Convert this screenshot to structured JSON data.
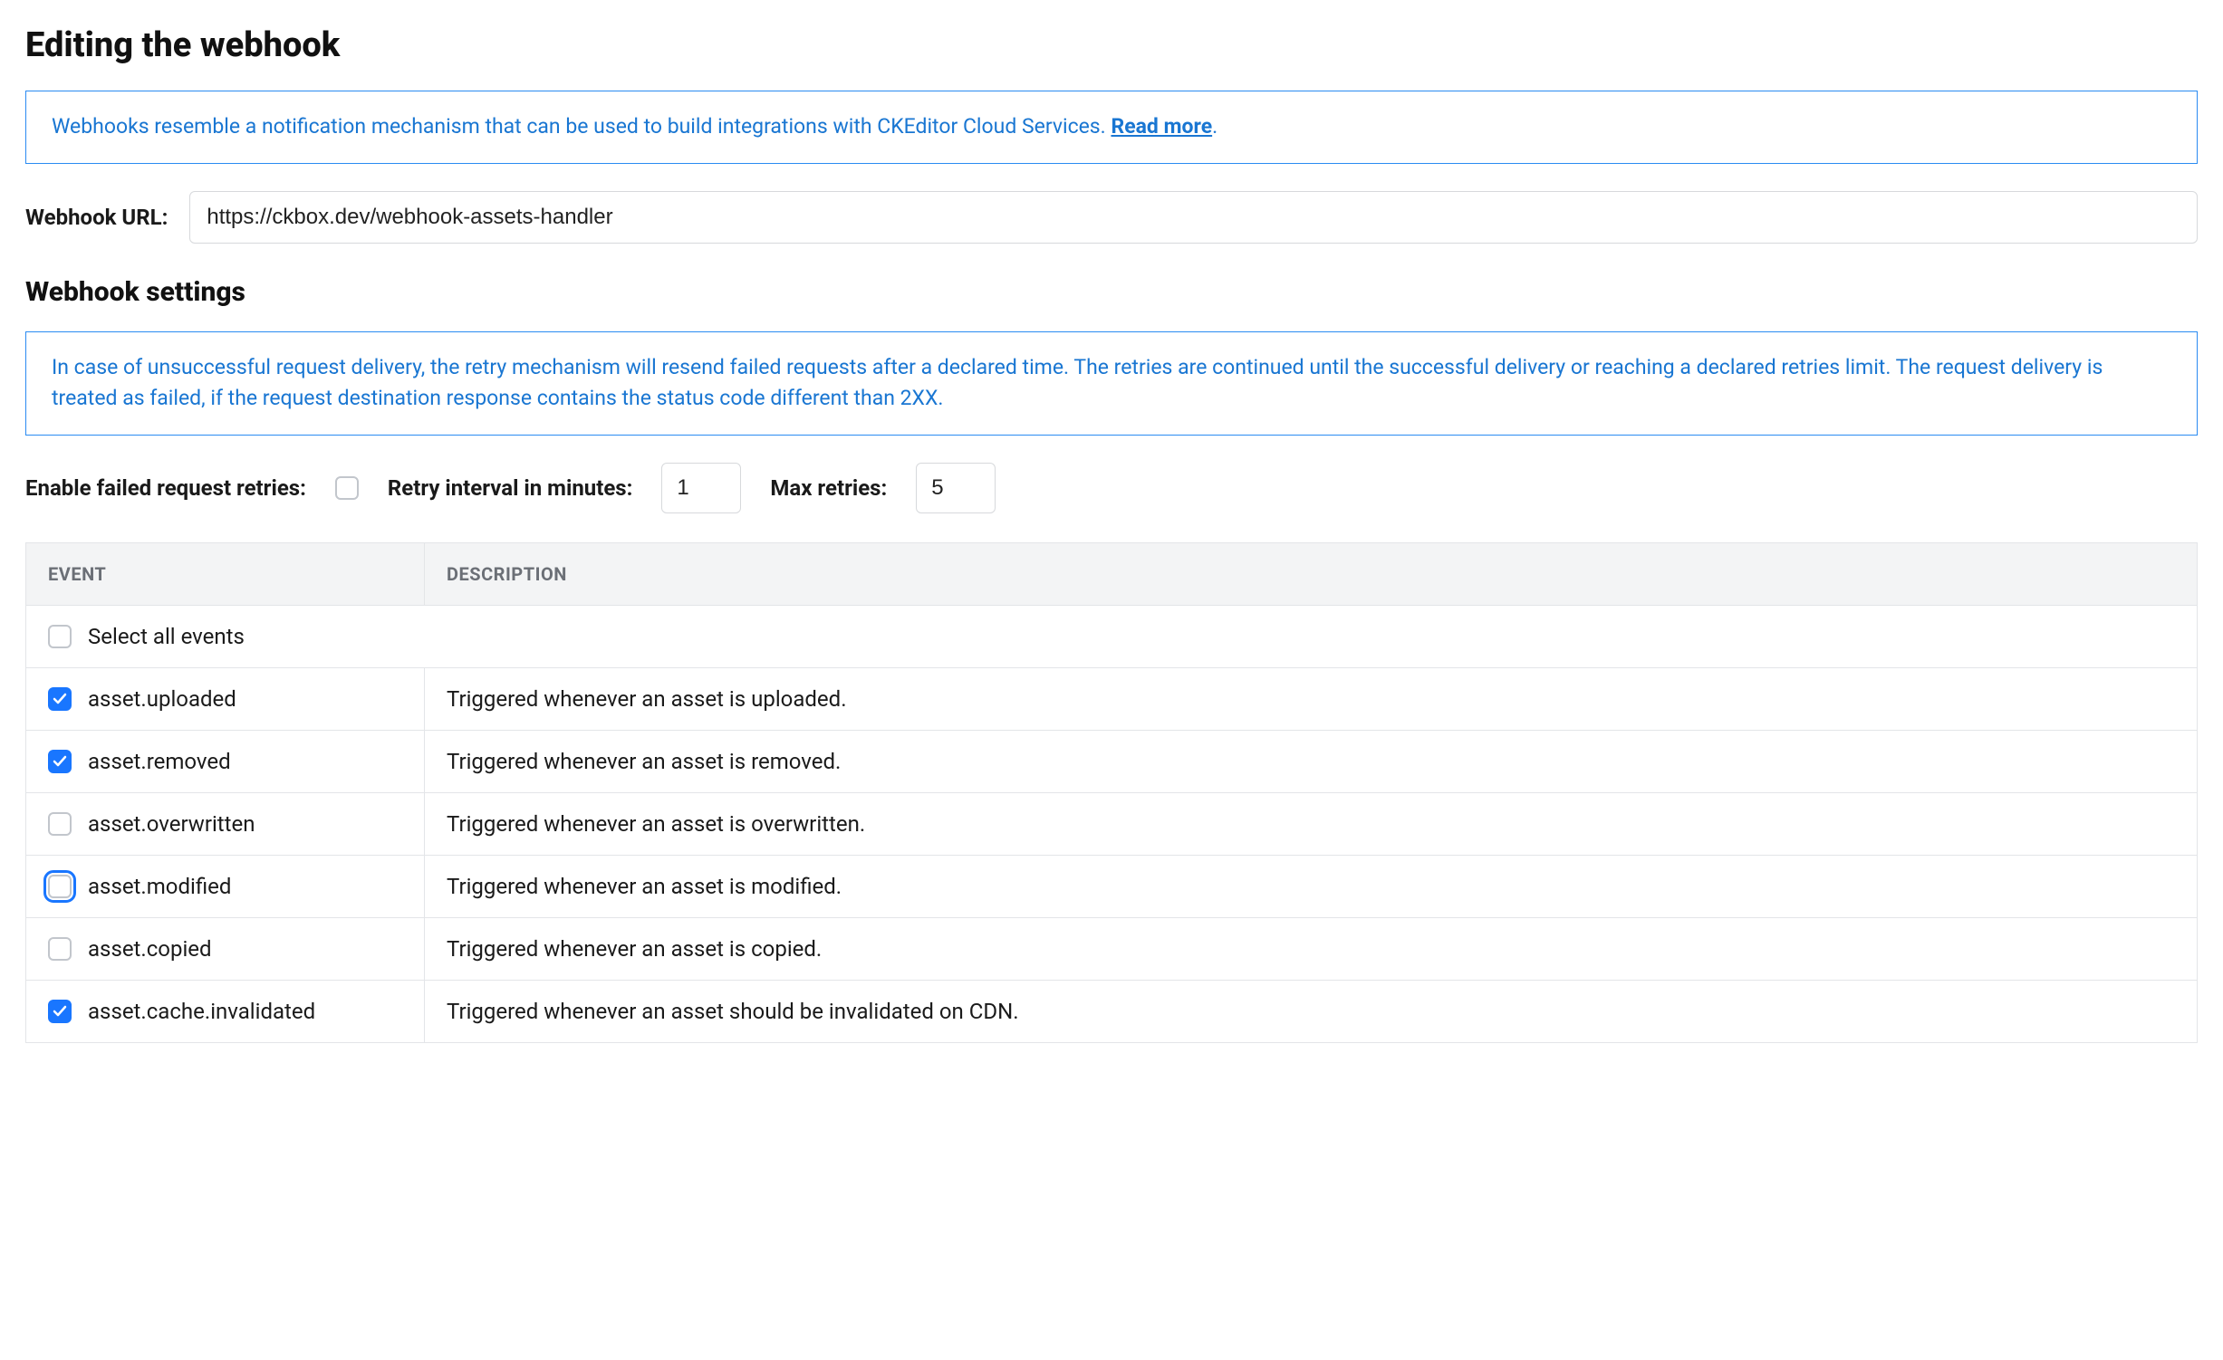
{
  "page_title": "Editing the webhook",
  "info1_text": "Webhooks resemble a notification mechanism that can be used to build integrations with CKEditor Cloud Services. ",
  "info1_link": "Read more",
  "info1_tail": ".",
  "url_label": "Webhook URL:",
  "url_value": "https://ckbox.dev/webhook-assets-handler",
  "settings_heading": "Webhook settings",
  "info2_text": "In case of unsuccessful request delivery, the retry mechanism will resend failed requests after a declared time. The retries are continued until the successful delivery or reaching a declared retries limit. The request delivery is treated as failed, if the request destination response contains the status code different than 2XX.",
  "enable_retries_label": "Enable failed request retries:",
  "enable_retries_checked": false,
  "retry_interval_label": "Retry interval in minutes:",
  "retry_interval_value": "1",
  "max_retries_label": "Max retries:",
  "max_retries_value": "5",
  "col_event": "EVENT",
  "col_desc": "DESCRIPTION",
  "select_all_label": "Select all events",
  "select_all_checked": false,
  "events": [
    {
      "name": "asset.uploaded",
      "desc": "Triggered whenever an asset is uploaded.",
      "checked": true,
      "focus": false
    },
    {
      "name": "asset.removed",
      "desc": "Triggered whenever an asset is removed.",
      "checked": true,
      "focus": false
    },
    {
      "name": "asset.overwritten",
      "desc": "Triggered whenever an asset is overwritten.",
      "checked": false,
      "focus": false
    },
    {
      "name": "asset.modified",
      "desc": "Triggered whenever an asset is modified.",
      "checked": false,
      "focus": true
    },
    {
      "name": "asset.copied",
      "desc": "Triggered whenever an asset is copied.",
      "checked": false,
      "focus": false
    },
    {
      "name": "asset.cache.invalidated",
      "desc": "Triggered whenever an asset should be invalidated on CDN.",
      "checked": true,
      "focus": false
    }
  ]
}
